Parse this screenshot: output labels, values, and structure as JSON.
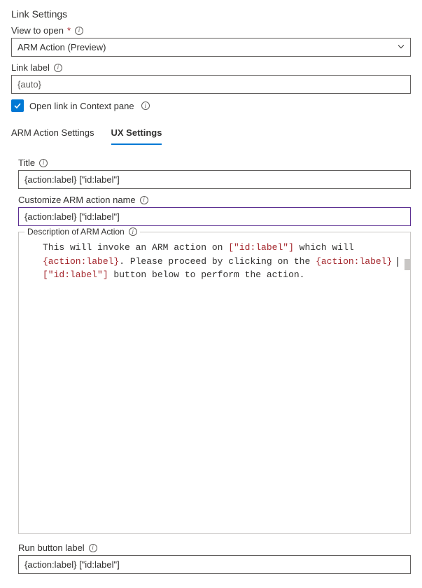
{
  "heading": "Link Settings",
  "view_to_open": {
    "label": "View to open",
    "value": "ARM Action (Preview)"
  },
  "link_label": {
    "label": "Link label",
    "value": "{auto}"
  },
  "open_context": {
    "label": "Open link in Context pane",
    "checked": true
  },
  "tabs": {
    "arm": "ARM Action Settings",
    "ux": "UX Settings"
  },
  "title_field": {
    "label": "Title",
    "value": "{action:label} [\"id:label\"]"
  },
  "custom_name": {
    "label": "Customize ARM action name",
    "value": "{action:label} [\"id:label\"]"
  },
  "description": {
    "label": "Description of ARM Action",
    "t1": "This will invoke an ARM action on ",
    "t2": "[\"id:label\"]",
    "t3": " which will ",
    "t4": "{action:label}",
    "t5": ". Please proceed by clicking on the ",
    "t6": "{action:label}",
    "t7": "[\"id:label\"]",
    "t8": " button below to perform the action."
  },
  "run_button": {
    "label": "Run button label",
    "value": "{action:label} [\"id:label\"]"
  }
}
